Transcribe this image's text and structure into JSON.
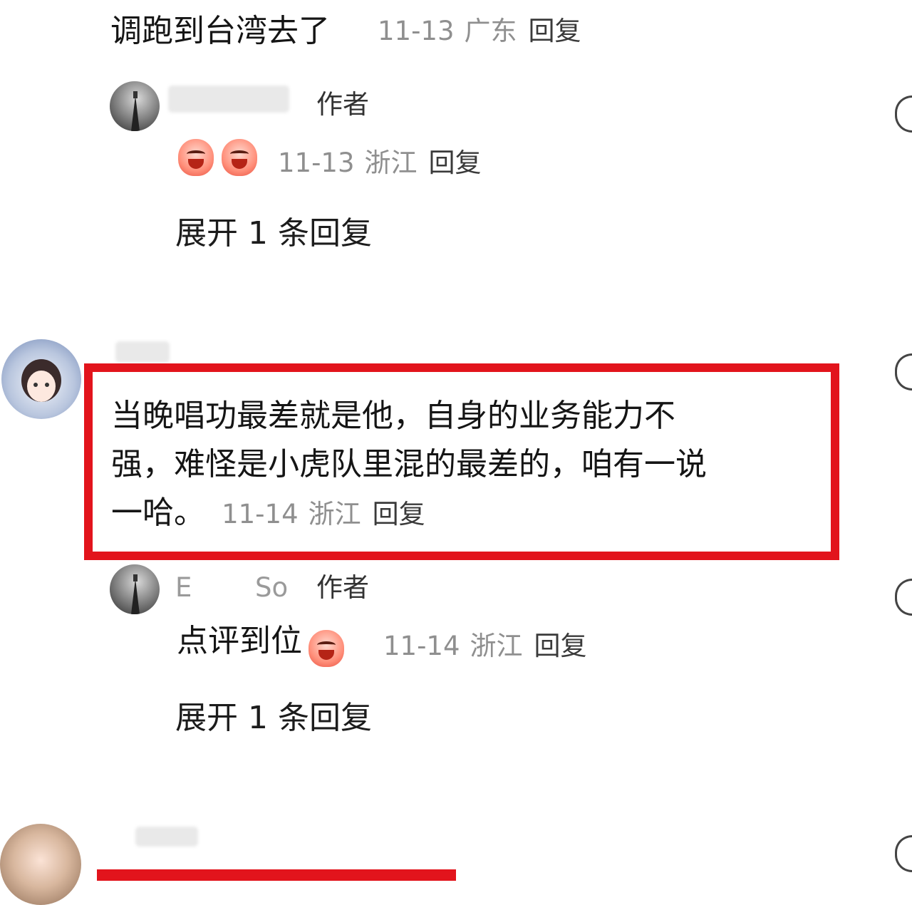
{
  "comments": [
    {
      "text": "调跑到台湾去了",
      "date": "11-13",
      "location": "广东",
      "reply_label": "回复"
    },
    {
      "author_tag": "作者",
      "date": "11-13",
      "location": "浙江",
      "reply_label": "回复",
      "expand_label": "展开 1 条回复"
    },
    {
      "text_line1": "当晚唱功最差就是他，自身的业务能力不",
      "text_line2": "强，难怪是小虎队里混的最差的，咱有一说",
      "text_line3": "一哈。",
      "date": "11-14",
      "location": "浙江",
      "reply_label": "回复"
    },
    {
      "author_name_start": "E",
      "author_name_end": "So",
      "author_tag": "作者",
      "text": "点评到位",
      "date": "11-14",
      "location": "浙江",
      "reply_label": "回复",
      "expand_label": "展开 1 条回复"
    }
  ],
  "colors": {
    "highlight_border": "#e2141c",
    "meta_text": "#8f8f8f",
    "main_text": "#151515"
  },
  "icons": [
    "like-heart-icon",
    "laugh-emoji-icon",
    "avatar-image"
  ]
}
